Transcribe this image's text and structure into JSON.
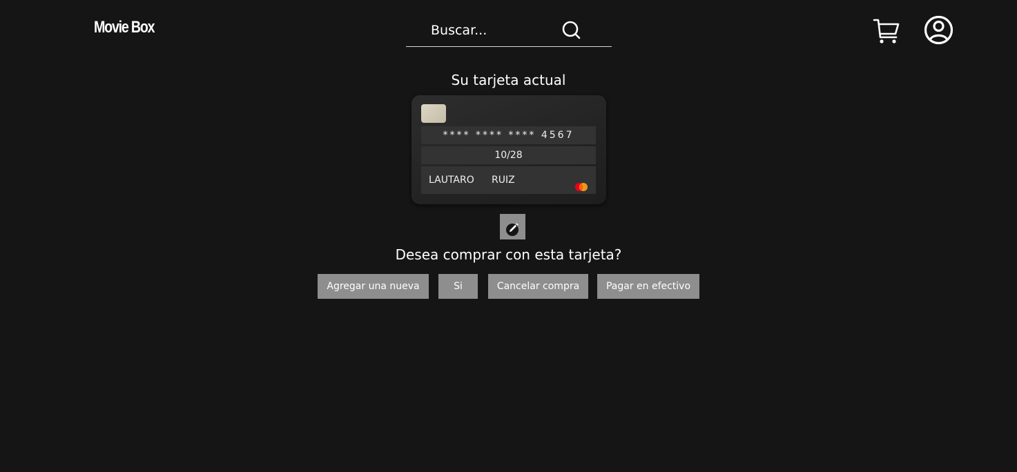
{
  "header": {
    "logo": "Movie Box",
    "search_placeholder": "Buscar...",
    "icons": {
      "search": "search-icon",
      "cart": "cart-icon",
      "user": "user-icon"
    }
  },
  "card_section": {
    "title": "Su tarjeta actual",
    "card": {
      "number": "**** **** **** 4567",
      "expiry": "10/28",
      "holder_first": "LAUTARO",
      "holder_last": "RUIZ",
      "brand_icon": "mastercard-icon"
    },
    "edit_icon": "edit-icon"
  },
  "question": "Desea comprar con esta tarjeta?",
  "actions": {
    "add_new": "Agregar una nueva",
    "yes": "Si",
    "cancel": "Cancelar compra",
    "cash": "Pagar en efectivo"
  },
  "colors": {
    "background": "#151515",
    "button": "#8e8e8e",
    "card_row": "#333333",
    "chip": "#d2cbb8"
  }
}
